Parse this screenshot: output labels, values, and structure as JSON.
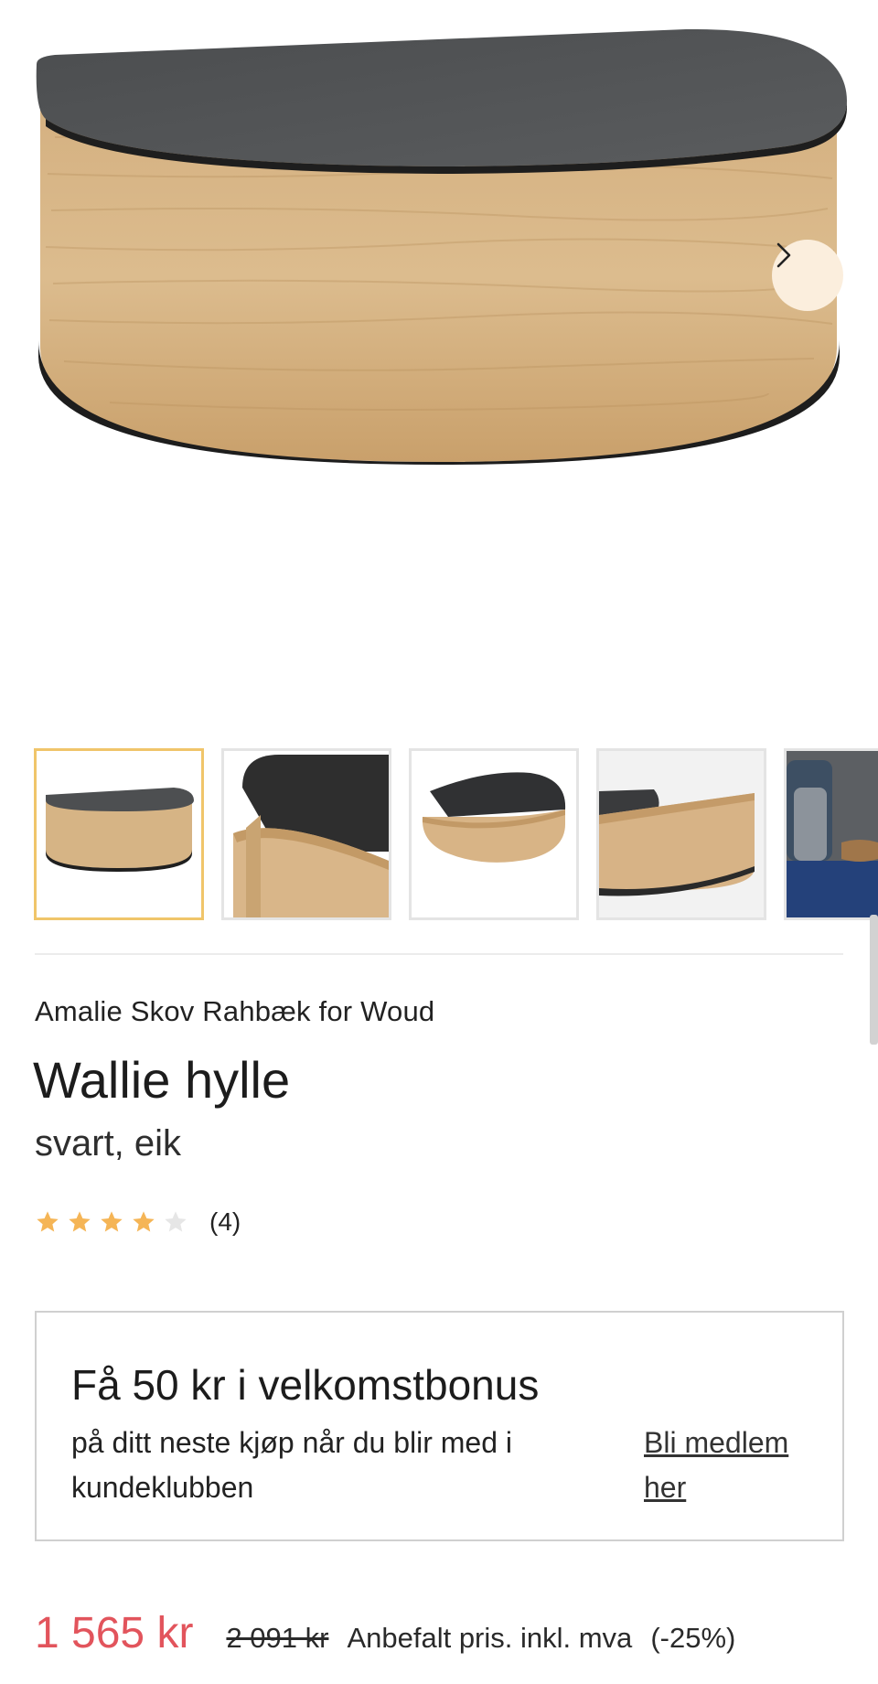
{
  "product_image": {
    "alt": "",
    "icon": "product-photo"
  },
  "gallery": {
    "next_icon": "chevron-right-icon",
    "thumbnails": [
      {
        "name": "thumbnail-1",
        "active": true
      },
      {
        "name": "thumbnail-2",
        "active": false
      },
      {
        "name": "thumbnail-3",
        "active": false
      },
      {
        "name": "thumbnail-4",
        "active": false
      },
      {
        "name": "thumbnail-5",
        "active": false
      }
    ]
  },
  "product": {
    "designer": "Amalie Skov Rahbæk",
    "for_word": "for",
    "brand": "Woud",
    "title": "Wallie hylle",
    "variant": "svart, eik",
    "rating": {
      "value": 4,
      "max": 5,
      "count": "(4)"
    }
  },
  "bonus": {
    "title": "Få 50 kr i velkomstbonus",
    "text": "på ditt neste kjøp når du blir med i kundeklubben",
    "link": "Bli medlem her"
  },
  "price": {
    "current": "1 565 kr",
    "original": "2 091 kr",
    "note": "Anbefalt pris. inkl. mva",
    "discount": "(-25%)"
  },
  "colors": {
    "accent_border": "#f0c56a",
    "price_red": "#e2545c",
    "star_filled": "#f5b556",
    "star_empty": "#e6e6e6",
    "next_button_bg": "#fbeedd"
  }
}
